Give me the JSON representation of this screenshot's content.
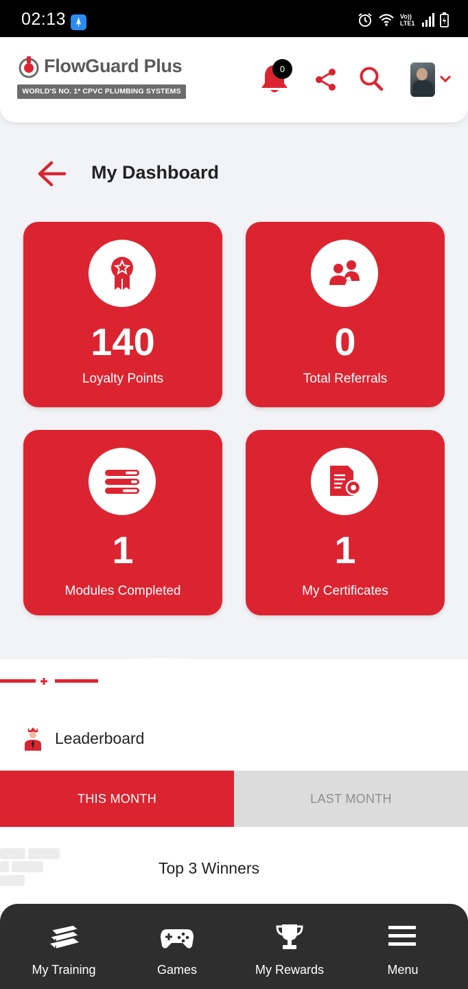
{
  "status_bar": {
    "time": "02:13",
    "network": "Vo)) LTE1"
  },
  "header": {
    "brand_name": "FlowGuard Plus",
    "tagline": "WORLD'S NO. 1* CPVC PLUMBING SYSTEMS",
    "notification_count": "0",
    "icons": [
      "bell-icon",
      "share-icon",
      "search-icon",
      "avatar",
      "chevron-down-icon"
    ]
  },
  "page": {
    "title": "My Dashboard"
  },
  "cards": [
    {
      "value": "140",
      "label": "Loyalty Points",
      "icon": "award-ribbon-icon"
    },
    {
      "value": "0",
      "label": "Total Referrals",
      "icon": "referral-people-icon"
    },
    {
      "value": "1",
      "label": "Modules Completed",
      "icon": "modules-list-icon"
    },
    {
      "value": "1",
      "label": "My Certificates",
      "icon": "certificate-icon"
    }
  ],
  "leaderboard": {
    "title": "Leaderboard",
    "tabs": [
      {
        "label": "THIS MONTH",
        "active": true
      },
      {
        "label": "LAST MONTH",
        "active": false
      }
    ],
    "section_title": "Top 3 Winners"
  },
  "bottom_nav": [
    {
      "label": "My Training",
      "icon": "books-icon"
    },
    {
      "label": "Games",
      "icon": "gamepad-icon"
    },
    {
      "label": "My Rewards",
      "icon": "trophy-icon"
    },
    {
      "label": "Menu",
      "icon": "menu-icon"
    }
  ],
  "colors": {
    "brand_red": "#dc2431",
    "nav_dark": "#2e2e2e",
    "page_bg": "#f2f3f6"
  }
}
